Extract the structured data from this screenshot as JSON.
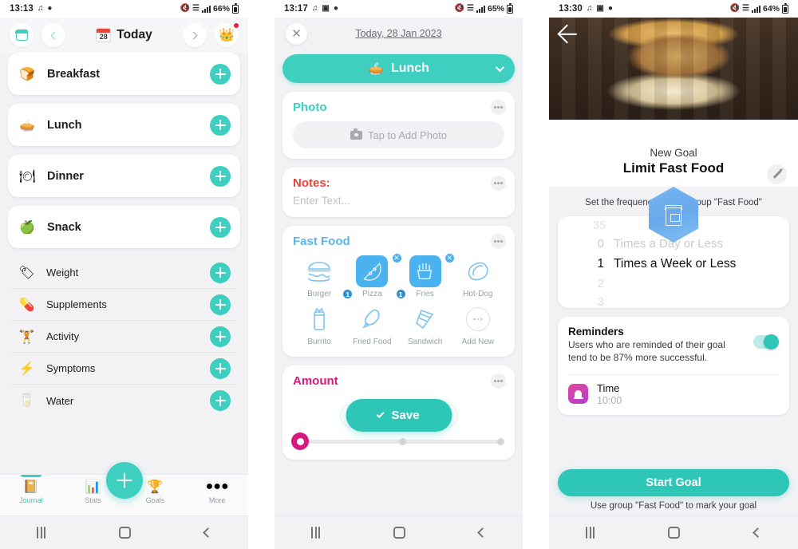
{
  "colors": {
    "teal": "#3ECFC0",
    "blue": "#49B2EF",
    "pink": "#D6197F",
    "red": "#E8453C",
    "bg": "#F2F2F5"
  },
  "panel1": {
    "status": {
      "time": "13:13",
      "battery": "66%",
      "icons": [
        "music-note-icon",
        "contact-icon",
        "mute-icon",
        "wifi-icon",
        "signal-icon"
      ]
    },
    "header": {
      "calendar_button": "calendar-icon",
      "prev_button": "chevron-left-icon",
      "date_badge": "28",
      "title": "Today",
      "next_button": "chevron-right-icon",
      "premium_button": "crown-icon"
    },
    "meals": [
      {
        "label": "Breakfast",
        "icon": "bread-icon",
        "add": "+"
      },
      {
        "label": "Lunch",
        "icon": "salad-bowl-icon",
        "add": "+"
      },
      {
        "label": "Dinner",
        "icon": "dinner-cloche-icon",
        "add": "+"
      },
      {
        "label": "Snack",
        "icon": "apple-icon",
        "add": "+"
      }
    ],
    "trackers": [
      {
        "label": "Weight",
        "icon": "scale-icon",
        "add": "+"
      },
      {
        "label": "Supplements",
        "icon": "pills-icon",
        "add": "+"
      },
      {
        "label": "Activity",
        "icon": "dumbbell-icon",
        "add": "+"
      },
      {
        "label": "Symptoms",
        "icon": "symptom-bolt-icon",
        "add": "+"
      },
      {
        "label": "Water",
        "icon": "water-glass-icon",
        "add": "+"
      }
    ],
    "tabs": [
      {
        "label": "Journal",
        "icon": "journal-icon",
        "active": true
      },
      {
        "label": "Stats",
        "icon": "stats-icon",
        "active": false
      },
      {
        "label": "Goals",
        "icon": "trophy-icon",
        "active": false
      },
      {
        "label": "More",
        "icon": "more-dots-icon",
        "active": false
      }
    ],
    "fab": "add-entry-fab"
  },
  "panel2": {
    "status": {
      "time": "13:17",
      "battery": "65%"
    },
    "close_button": "close-icon",
    "date": "Today, 28 Jan 2023",
    "meal_selector": {
      "label": "Lunch",
      "icon": "salad-bowl-icon"
    },
    "photo": {
      "title": "Photo",
      "placeholder": "Tap to Add Photo",
      "menu": "overflow-menu"
    },
    "notes": {
      "title": "Notes:",
      "placeholder": "Enter Text...",
      "menu": "overflow-menu"
    },
    "fast_food": {
      "title": "Fast Food",
      "menu": "overflow-menu",
      "items": [
        {
          "label": "Burger",
          "selected": false,
          "count": null
        },
        {
          "label": "Pizza",
          "selected": true,
          "count": "1"
        },
        {
          "label": "Fries",
          "selected": true,
          "count": "1"
        },
        {
          "label": "Hot-Dog",
          "selected": false,
          "count": null
        },
        {
          "label": "Burrito",
          "selected": false,
          "count": null
        },
        {
          "label": "Fried Food",
          "selected": false,
          "count": null
        },
        {
          "label": "Sandwich",
          "selected": false,
          "count": null
        },
        {
          "label": "Add New",
          "selected": false,
          "count": null
        }
      ]
    },
    "amount": {
      "title": "Amount",
      "menu": "overflow-menu",
      "save_label": "Save"
    }
  },
  "panel3": {
    "status": {
      "time": "13:30",
      "battery": "64%"
    },
    "back_button": "back-arrow-icon",
    "badge_icon": "food-bag-icon",
    "edit_button": "pencil-icon",
    "subtitle": "New Goal",
    "title": "Limit Fast Food",
    "frequency_note": "Set the frequency for the group \"Fast Food\"",
    "picker": {
      "rows": [
        {
          "num": "35",
          "text": "",
          "state": "faint2"
        },
        {
          "num": "0",
          "text": "Times a Day or Less",
          "state": "faint"
        },
        {
          "num": "1",
          "text": "Times a Week or Less",
          "state": "selected"
        },
        {
          "num": "2",
          "text": "",
          "state": "faint3"
        },
        {
          "num": "3",
          "text": "",
          "state": "faint3"
        }
      ],
      "selected_value": "1",
      "selected_unit": "Times a Week or Less"
    },
    "reminders": {
      "title": "Reminders",
      "description": "Users who are reminded of their goal tend to be 87% more successful.",
      "toggle_on": true,
      "time_label": "Time",
      "time_value": "10:00"
    },
    "start_button": "Start Goal",
    "start_note": "Use group \"Fast Food\" to mark your goal"
  }
}
